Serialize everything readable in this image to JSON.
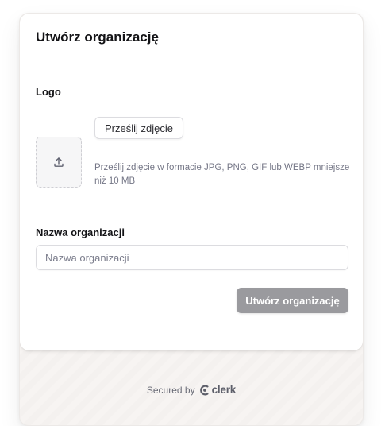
{
  "form": {
    "title": "Utwórz organizację",
    "logo_label": "Logo",
    "upload_button": "Prześlij zdjęcie",
    "upload_hint": "Prześlij zdjęcie w formacie JPG, PNG, GIF lub WEBP mniejsze niż 10 MB",
    "upload_icon": "upload-icon",
    "name_label": "Nazwa organizacji",
    "name_placeholder": "Nazwa organizacji",
    "name_value": "",
    "submit_button": "Utwórz organizację"
  },
  "footer": {
    "secured_by": "Secured by",
    "brand": "clerk",
    "brand_icon": "clerk-logo-icon"
  },
  "colors": {
    "submit_disabled": "#9a9a9e",
    "footer_bg": "#f7f4f2"
  }
}
